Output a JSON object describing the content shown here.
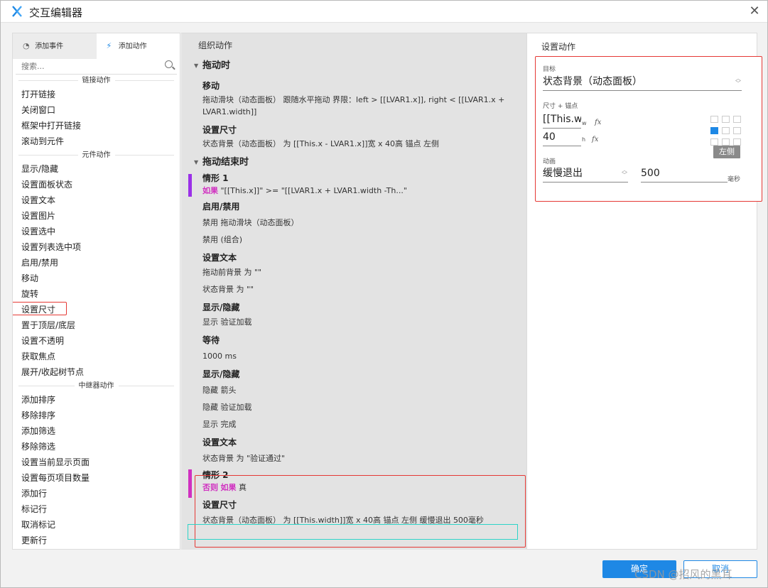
{
  "window": {
    "title": "交互编辑器",
    "close_label": "✕"
  },
  "left": {
    "tabs": [
      {
        "label": "添加事件",
        "icon": "event-icon"
      },
      {
        "label": "添加动作",
        "icon": "action-icon"
      }
    ],
    "search_placeholder": "搜索...",
    "sections": [
      {
        "title": "链接动作",
        "items": [
          "打开链接",
          "关闭窗口",
          "框架中打开链接",
          "滚动到元件"
        ]
      },
      {
        "title": "元件动作",
        "items": [
          "显示/隐藏",
          "设置面板状态",
          "设置文本",
          "设置图片",
          "设置选中",
          "设置列表选中项",
          "启用/禁用",
          "移动",
          "旋转",
          "设置尺寸",
          "置于顶层/底层",
          "设置不透明",
          "获取焦点",
          "展开/收起树节点"
        ]
      },
      {
        "title": "中继器动作",
        "items": [
          "添加排序",
          "移除排序",
          "添加筛选",
          "移除筛选",
          "设置当前显示页面",
          "设置每页项目数量",
          "添加行",
          "标记行",
          "取消标记",
          "更新行"
        ]
      }
    ]
  },
  "middle": {
    "header": "组织动作",
    "drag": {
      "event": "拖动时",
      "actions": [
        {
          "title": "移动",
          "desc": "拖动滑块（动态面板） 跟随水平拖动 界限：left > [[LVAR1.x]], right < [[LVAR1.x + LVAR1.width]]"
        },
        {
          "title": "设置尺寸",
          "desc": "状态背景（动态面板） 为 [[This.x - LVAR1.x]]宽 x 40高 锚点 左侧"
        }
      ]
    },
    "drag_end": {
      "event": "拖动结束时",
      "case1": {
        "title": "情形 1",
        "cond_kw": "如果",
        "cond": "\"[[This.x]]\" >= \"[[LVAR1.x + LVAR1.width -Th...\"",
        "color": "#9b30e8"
      },
      "case1_actions": [
        {
          "title": "启用/禁用",
          "lines": [
            "禁用 拖动滑块（动态面板）",
            "禁用 (组合)"
          ]
        },
        {
          "title": "设置文本",
          "lines": [
            "拖动前背景 为 \"\"",
            "状态背景 为 \"\""
          ]
        },
        {
          "title": "显示/隐藏",
          "lines": [
            "显示 验证加载"
          ]
        },
        {
          "title": "等待",
          "lines": [
            "1000 ms"
          ]
        },
        {
          "title": "显示/隐藏",
          "lines": [
            "隐藏 箭头",
            "隐藏 验证加载",
            "显示 完成"
          ]
        },
        {
          "title": "设置文本",
          "lines": [
            "状态背景 为 \"验证通过\""
          ]
        }
      ],
      "case2": {
        "title": "情形 2",
        "kw1": "否则",
        "kw2": "如果",
        "cond": "真",
        "color": "#d030c0"
      },
      "case2_action": {
        "title": "设置尺寸",
        "desc": "状态背景（动态面板） 为 [[This.width]]宽 x 40高 锚点 左侧 缓慢退出 500毫秒"
      }
    }
  },
  "right": {
    "header": "设置动作",
    "target_label": "目标",
    "target_value": "状态背景（动态面板）",
    "size_label": "尺寸 + 锚点",
    "width_value": "[[This.wi",
    "width_sub": "w",
    "height_value": "40",
    "height_sub": "h",
    "fx": "fx",
    "anchor_tooltip": "左侧",
    "anim_label": "动画",
    "anim_value": "缓慢退出",
    "duration_value": "500",
    "duration_unit": "毫秒"
  },
  "footer": {
    "ok_label": "确定",
    "cancel_label": "取消"
  },
  "watermark": "CSDN @招风的黑耳"
}
